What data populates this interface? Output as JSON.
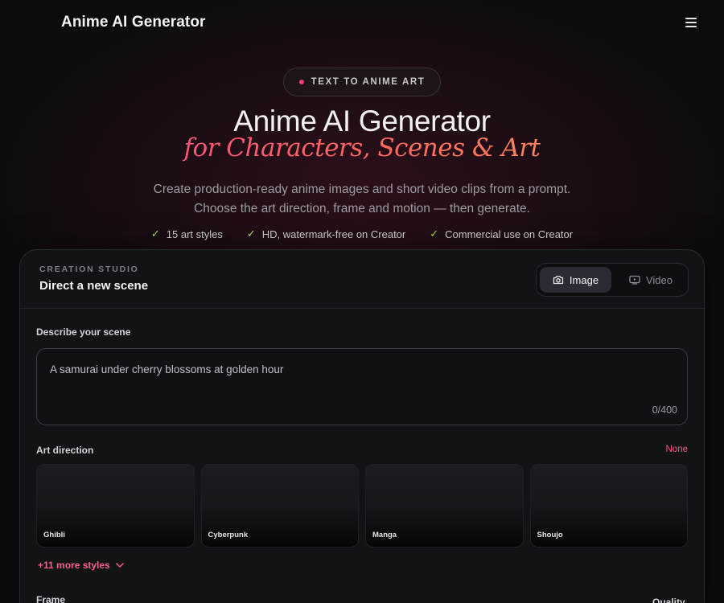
{
  "header": {
    "brand": "Anime AI Generator"
  },
  "hero": {
    "badge": "TEXT TO ANIME ART",
    "title": "Anime AI Generator",
    "subtitle": "for Characters, Scenes & Art",
    "description_line1": "Create production-ready anime images and short video clips from a prompt.",
    "description_line2": "Choose the art direction, frame and motion — then generate.",
    "features": [
      "15 art styles",
      "HD, watermark-free on Creator",
      "Commercial use on Creator"
    ]
  },
  "studio": {
    "eyebrow": "CREATION STUDIO",
    "title": "Direct a new scene",
    "modes": {
      "image": "Image",
      "video": "Video",
      "selected": "Image"
    },
    "prompt": {
      "label": "Describe your scene",
      "placeholder": "A samurai under cherry blossoms at golden hour",
      "value": "",
      "counter": "0/400"
    },
    "art_direction": {
      "label": "Art direction",
      "selection": "None",
      "styles": [
        "Ghibli",
        "Cyberpunk",
        "Manga",
        "Shoujo"
      ],
      "more": "+11 more styles"
    },
    "frame_label": "Frame",
    "quality_label": "Quality"
  },
  "colors": {
    "accent": "#ff4d87",
    "check": "#b9e34a",
    "panel": "#121317"
  }
}
